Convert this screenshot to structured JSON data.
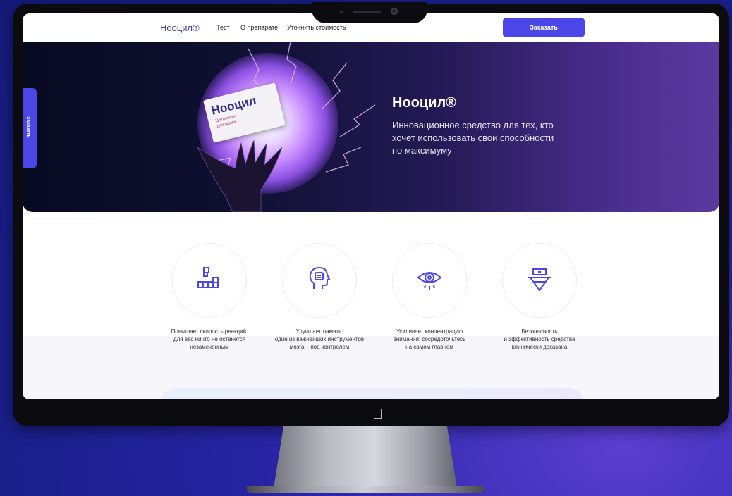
{
  "nav": {
    "logo": "Нооцил®",
    "links": [
      "Тест",
      "О препарате",
      "Уточнить стоимость"
    ],
    "order_button": "Заказать"
  },
  "side_tab": {
    "label": "Заказать"
  },
  "hero": {
    "title": "Нооцил®",
    "text": "Инновационное средство для тех, кто хочет использовать свои способности по максимуму",
    "product_box": {
      "name": "Нооцил",
      "line1": "Цитиколин",
      "line2": "для мозга"
    }
  },
  "features": [
    {
      "icon": "blocks-icon",
      "text": "Повышает скорость реакций:\nдля вас ничто не останется\nнезамеченным"
    },
    {
      "icon": "head-brain-icon",
      "text": "Улучшает память:\nодин из важнейших инструментов\nмозга – под контролем"
    },
    {
      "icon": "eye-icon",
      "text": "Усиливает концентрацию\nвнимания: сосредоточьтесь\nна самом главном"
    },
    {
      "icon": "medical-shield-icon",
      "text": "Безопасность\nи эффективность средства\nклинически доказана"
    }
  ],
  "colors": {
    "accent": "#4a46e8",
    "hero_dark": "#0e1030",
    "hero_purple": "#5a3aa0",
    "background": "#1a1f8a"
  }
}
